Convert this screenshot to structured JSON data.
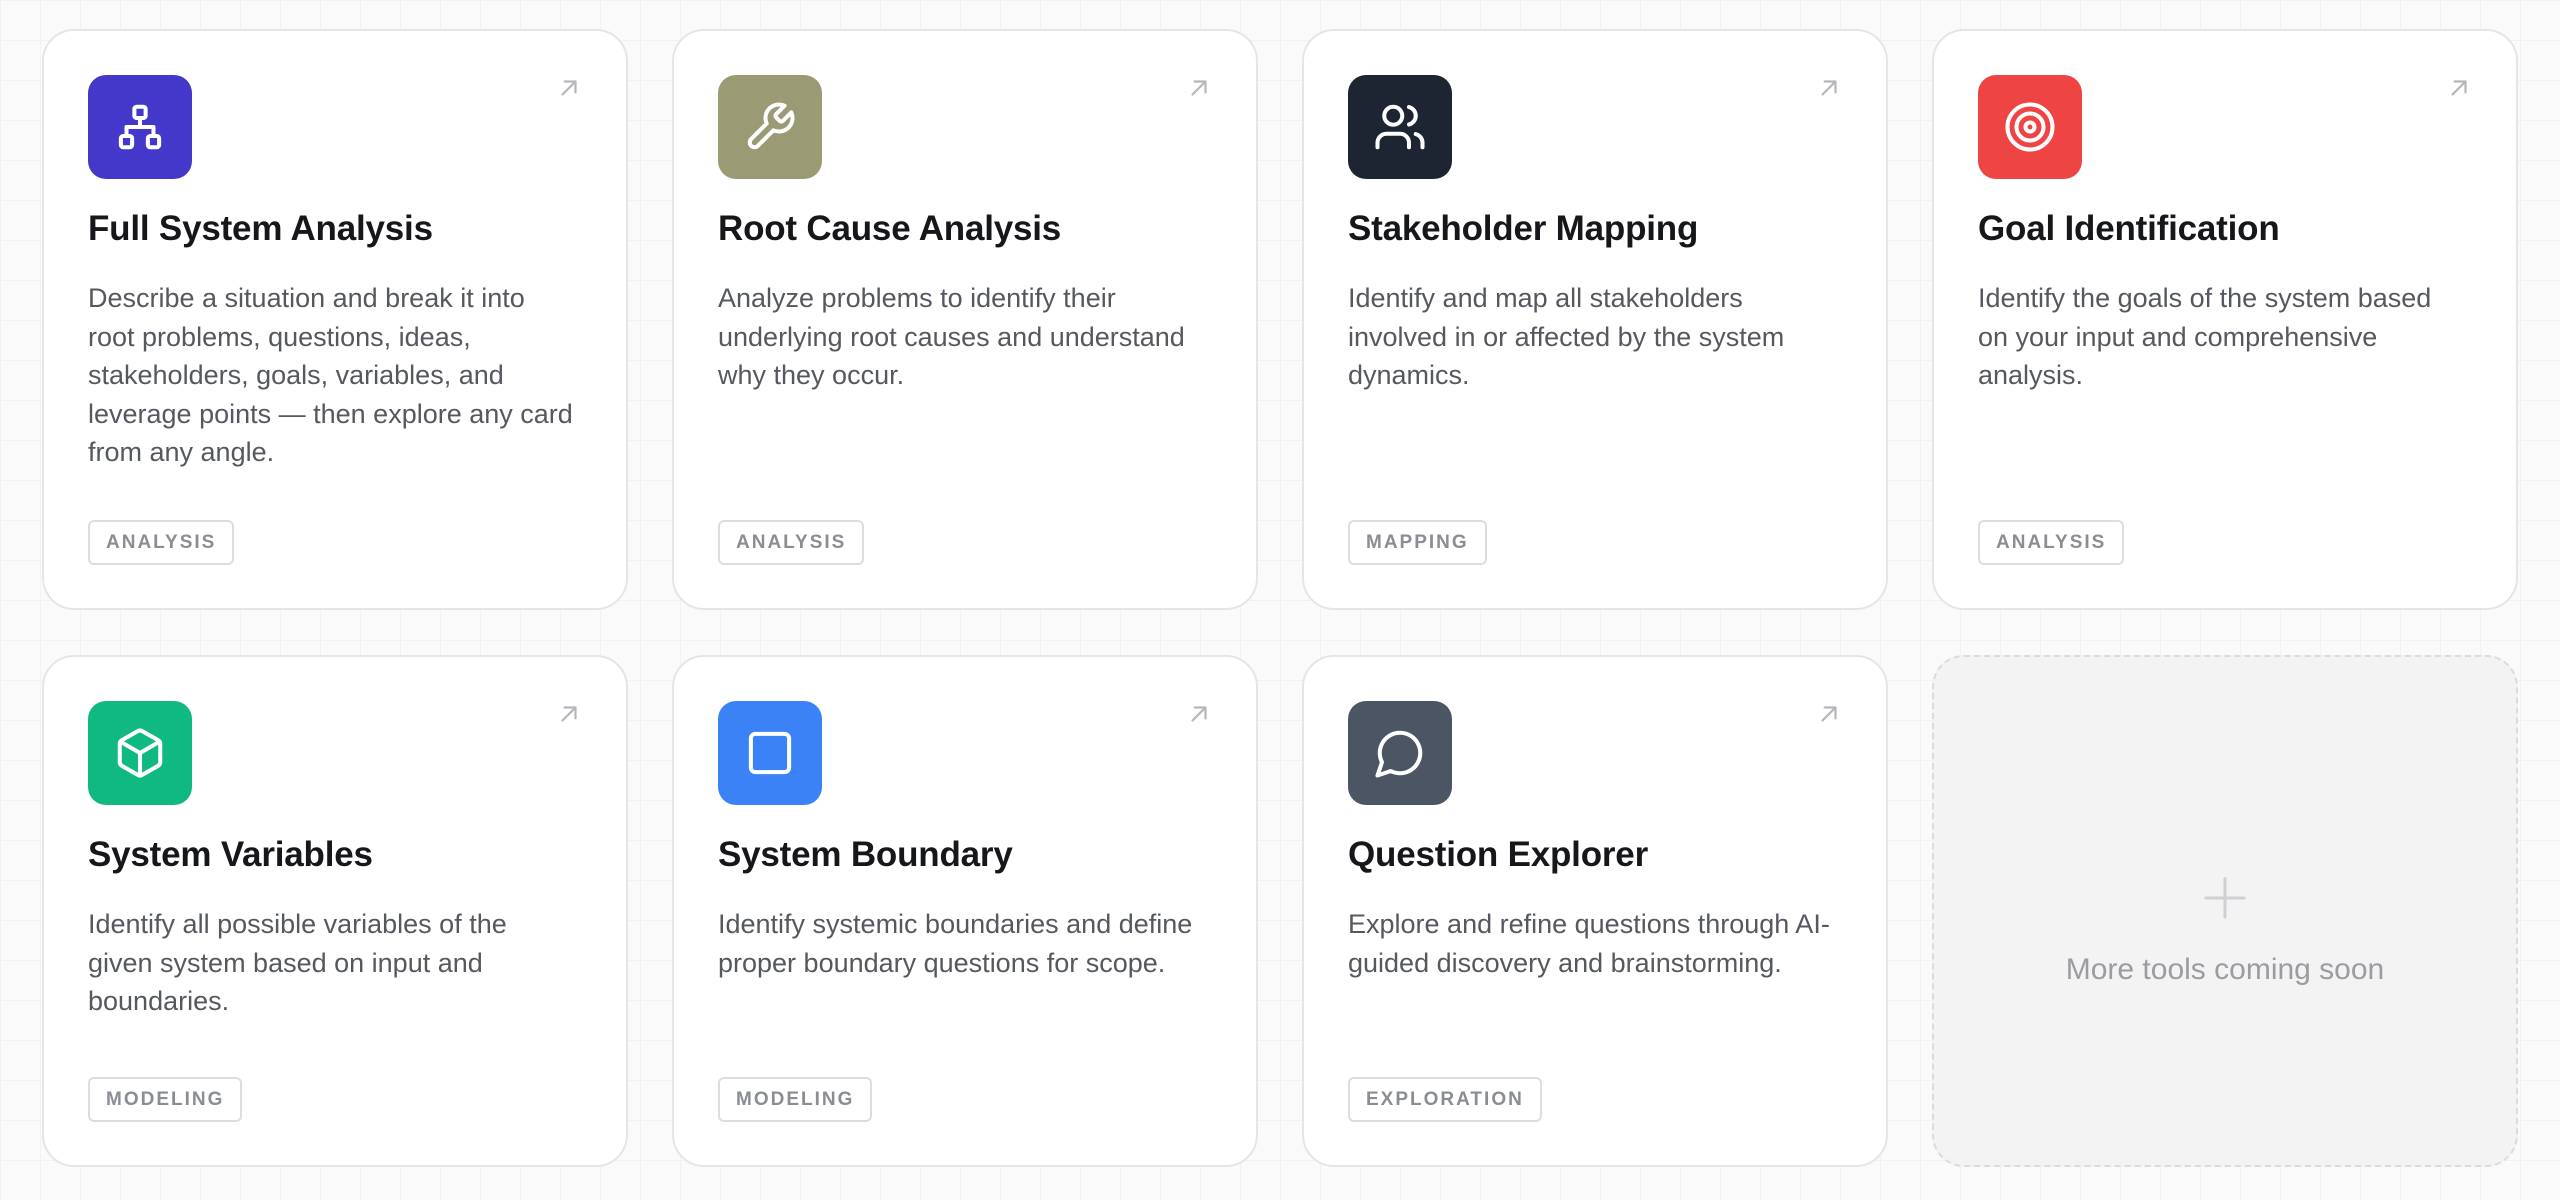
{
  "cards": [
    {
      "title": "Full System Analysis",
      "description": "Describe a situation and break it into root problems, questions, ideas, stakeholders, goals, variables, and leverage points — then explore any card from any angle.",
      "tag": "ANALYSIS",
      "icon": "hierarchy-icon",
      "color": "#4338ca"
    },
    {
      "title": "Root Cause Analysis",
      "description": "Analyze problems to identify their underlying root causes and understand why they occur.",
      "tag": "ANALYSIS",
      "icon": "wrench-icon",
      "color": "#9a9a74"
    },
    {
      "title": "Stakeholder Mapping",
      "description": "Identify and map all stakeholders involved in or affected by the system dynamics.",
      "tag": "MAPPING",
      "icon": "users-icon",
      "color": "#1e2532"
    },
    {
      "title": "Goal Identification",
      "description": "Identify the goals of the system based on your input and comprehensive analysis.",
      "tag": "ANALYSIS",
      "icon": "target-icon",
      "color": "#ef4444"
    },
    {
      "title": "System Variables",
      "description": "Identify all possible variables of the given system based on input and boundaries.",
      "tag": "MODELING",
      "icon": "cube-icon",
      "color": "#10b981"
    },
    {
      "title": "System Boundary",
      "description": "Identify systemic boundaries and define proper boundary questions for scope.",
      "tag": "MODELING",
      "icon": "square-icon",
      "color": "#3b82f6"
    },
    {
      "title": "Question Explorer",
      "description": "Explore and refine questions through AI-guided discovery and brainstorming.",
      "tag": "EXPLORATION",
      "icon": "chat-bubble-icon",
      "color": "#4b5563"
    }
  ],
  "coming_soon": {
    "label": "More tools coming soon",
    "icon": "plus-icon"
  }
}
